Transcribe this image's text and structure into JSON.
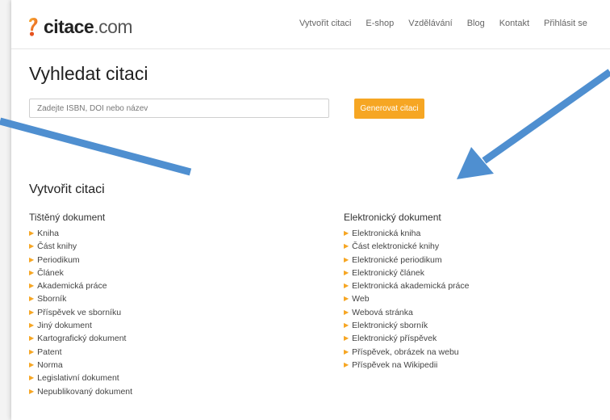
{
  "logo": {
    "brand": "citace",
    "domain": ".com"
  },
  "nav": [
    "Vytvořit citaci",
    "E-shop",
    "Vzdělávání",
    "Blog",
    "Kontakt",
    "Přihlásit se"
  ],
  "search": {
    "title": "Vyhledat citaci",
    "placeholder": "Zadejte ISBN, DOI nebo název",
    "button": "Generovat citaci"
  },
  "create": {
    "title": "Vytvořit citaci",
    "printed": {
      "title": "Tištěný dokument",
      "items": [
        "Kniha",
        "Část knihy",
        "Periodikum",
        "Článek",
        "Akademická práce",
        "Sborník",
        "Příspěvek ve sborníku",
        "Jiný dokument",
        "Kartografický dokument",
        "Patent",
        "Norma",
        "Legislativní dokument",
        "Nepublikovaný dokument"
      ]
    },
    "electronic": {
      "title": "Elektronický dokument",
      "items": [
        "Elektronická kniha",
        "Část elektronické knihy",
        "Elektronické periodikum",
        "Elektronický článek",
        "Elektronická akademická práce",
        "Web",
        "Webová stránka",
        "Elektronický sborník",
        "Elektronický příspěvek",
        "Příspěvek, obrázek na webu",
        "Příspěvek na Wikipedii"
      ]
    }
  },
  "colors": {
    "accent": "#f6a623",
    "arrow": "#4f8fd0"
  },
  "icons": {
    "logo": "quote-mark-icon",
    "list_marker": "triangle-right-icon",
    "annotation": "arrow-icon"
  }
}
